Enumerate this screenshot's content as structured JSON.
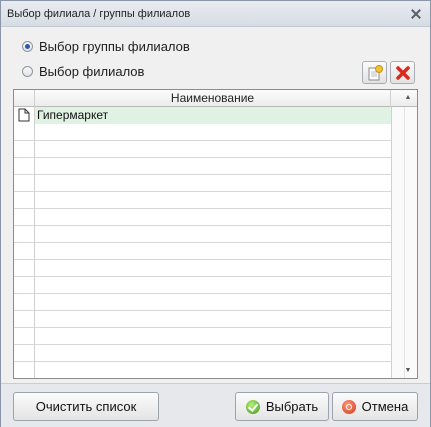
{
  "window": {
    "title": "Выбор филиала / группы филиалов"
  },
  "options": [
    {
      "label": "Выбор группы филиалов",
      "checked": true
    },
    {
      "label": "Выбор филиалов",
      "checked": false
    }
  ],
  "toolbar": {
    "add_icon": "add-item-icon",
    "delete_icon": "delete-x-icon"
  },
  "grid": {
    "column_header": "Наименование",
    "rows": [
      {
        "name": "Гипермаркет",
        "selected": true,
        "icon": "document-icon"
      }
    ],
    "empty_rows": 14
  },
  "buttons": {
    "clear": "Очистить список",
    "select": "Выбрать",
    "cancel": "Отмена"
  },
  "colors": {
    "selected_row": "#dff2e3",
    "delete_red": "#d92b1d"
  }
}
